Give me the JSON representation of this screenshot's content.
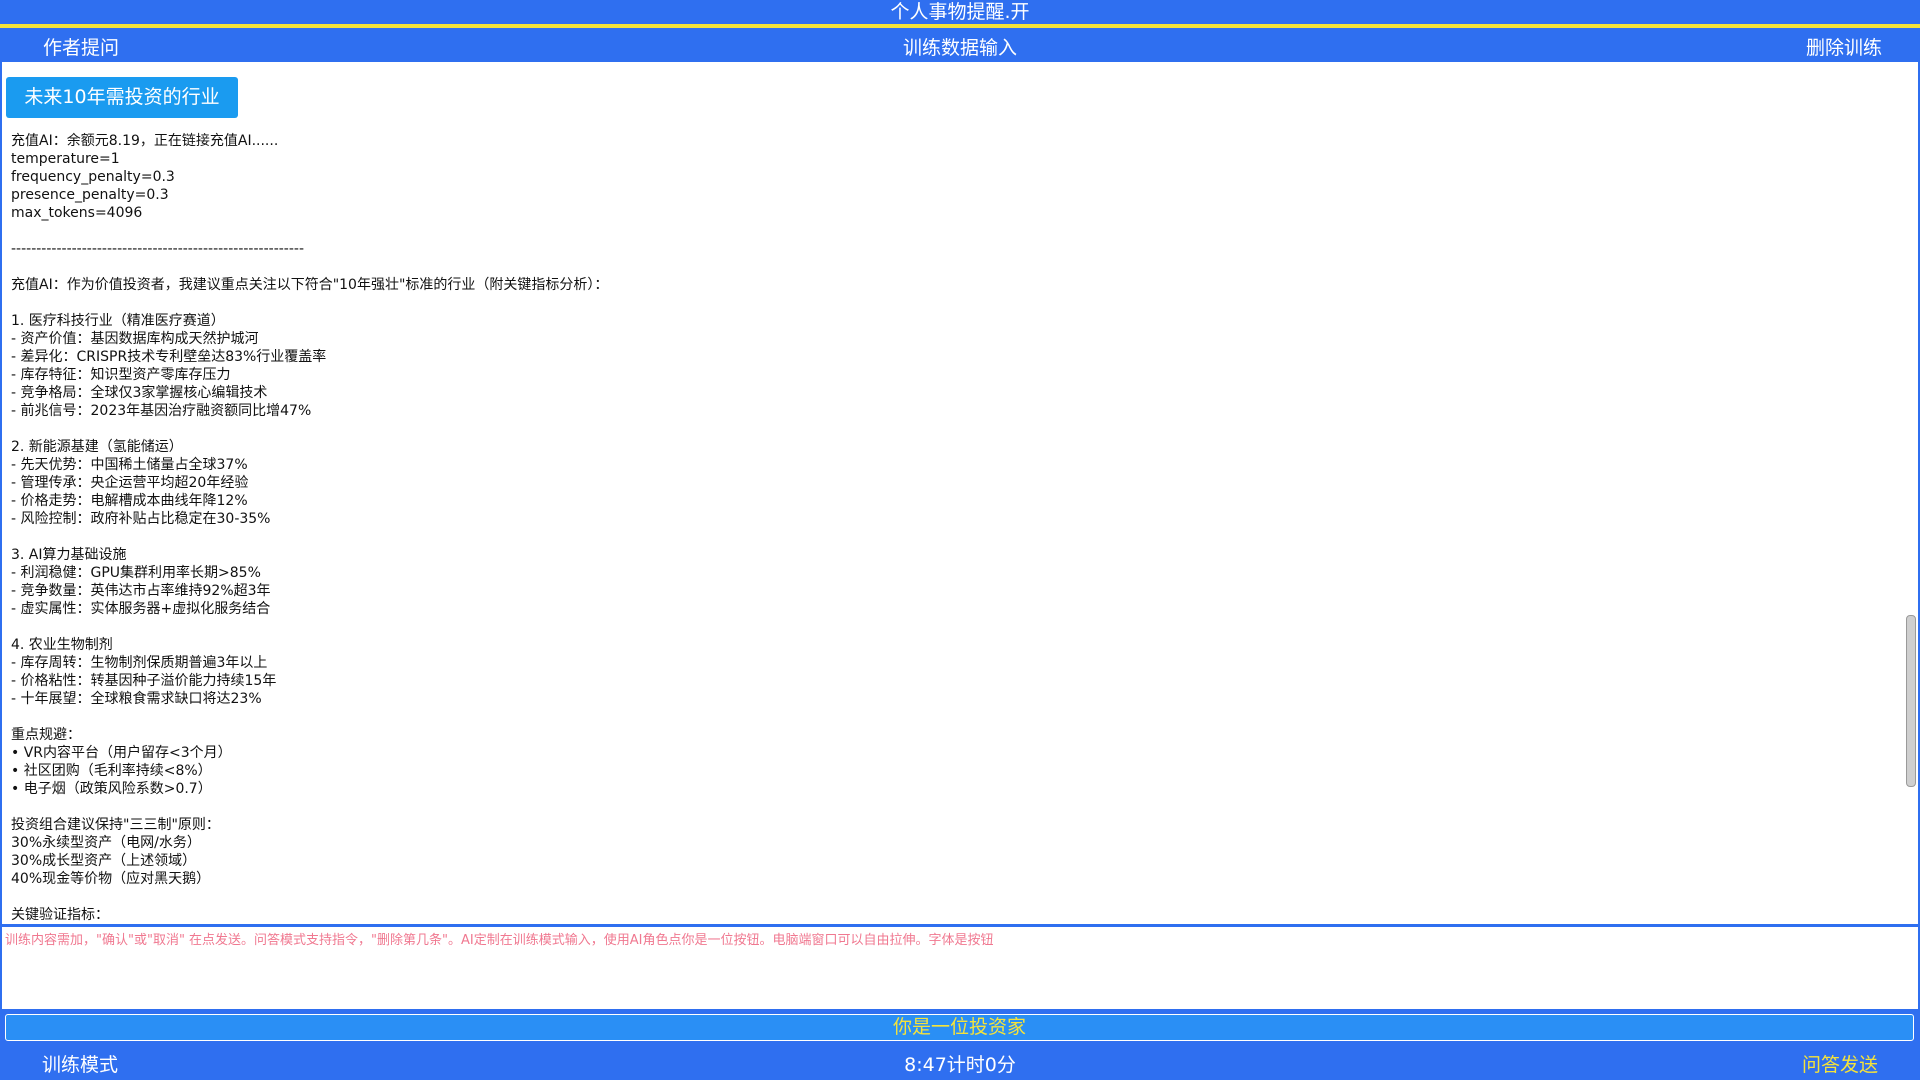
{
  "window": {
    "title": "个人事物提醒.开"
  },
  "toolbar": {
    "ask_author": "作者提问",
    "training_input": "训练数据输入",
    "delete_training": "删除训练"
  },
  "topic_button": {
    "label": "未来10年需投资的行业"
  },
  "output_lines": [
    "充值AI：余额元8.19，正在链接充值AI......",
    "temperature=1",
    "frequency_penalty=0.3",
    "presence_penalty=0.3",
    "max_tokens=4096",
    "",
    "----------------------------------------------------------",
    "",
    "充值AI：作为价值投资者，我建议重点关注以下符合\"10年强壮\"标准的行业（附关键指标分析）：",
    "",
    "1. 医疗科技行业（精准医疗赛道）",
    "- 资产价值：基因数据库构成天然护城河",
    "- 差异化：CRISPR技术专利壁垒达83%行业覆盖率",
    "- 库存特征：知识型资产零库存压力",
    "- 竞争格局：全球仅3家掌握核心编辑技术",
    "- 前兆信号：2023年基因治疗融资额同比增47%",
    "",
    "2. 新能源基建（氢能储运）",
    "- 先天优势：中国稀土储量占全球37%",
    "- 管理传承：央企运营平均超20年经验",
    "- 价格走势：电解槽成本曲线年降12%",
    "- 风险控制：政府补贴占比稳定在30-35%",
    "",
    "3. AI算力基础设施",
    "- 利润稳健：GPU集群利用率长期>85%",
    "- 竞争数量：英伟达市占率维持92%超3年",
    "- 虚实属性：实体服务器+虚拟化服务结合",
    "",
    "4. 农业生物制剂",
    "- 库存周转：生物制剂保质期普遍3年以上",
    "- 价格粘性：转基因种子溢价能力持续15年",
    "- 十年展望：全球粮食需求缺口将达23%",
    "",
    "重点规避：",
    "• VR内容平台（用户留存<3个月）",
    "• 社区团购（毛利率持续<8%）",
    "• 电子烟（政策风险系数>0.7）",
    "",
    "投资组合建议保持\"三三制\"原则：",
    "30%永续型资产（电网/水务）",
    "30%成长型资产（上述领域）",
    "40%现金等价物（应对黑天鹅）",
    "",
    "关键验证指标："
  ],
  "input": {
    "placeholder": "训练内容需加，\"确认\"或\"取消\" 在点发送。问答模式支持指令，\"删除第几条\"。AI定制在训练模式输入，使用AI角色点你是一位按钮。电脑端窗口可以自由拉伸。字体是按钮",
    "value": ""
  },
  "role_button": {
    "label": "你是一位投资家"
  },
  "bottom": {
    "mode_label": "训练模式",
    "timer": "8:47计时0分",
    "send_label": "问答发送"
  },
  "colors": {
    "bar_blue": "#2f6ff0",
    "accent_yellow": "#f5e33a",
    "button_blue": "#1a9bf0",
    "placeholder_pink": "#f07890"
  }
}
